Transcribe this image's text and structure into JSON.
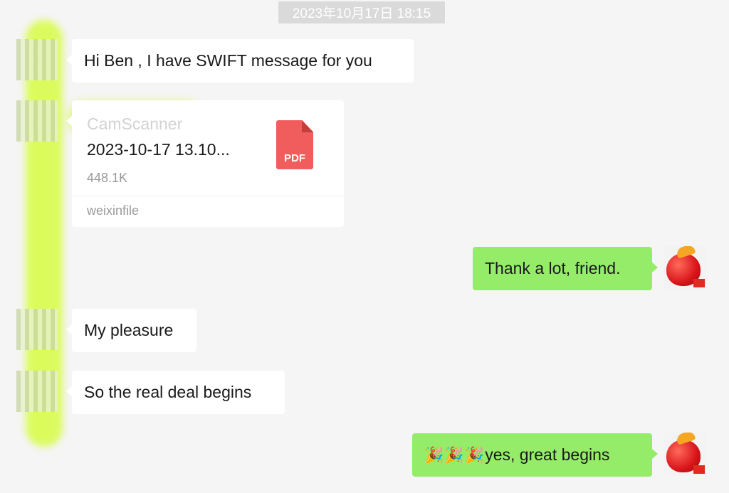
{
  "timestamp": "2023年10月17日 18:15",
  "messages": [
    {
      "text": "Hi Ben , I have SWIFT message for you"
    },
    {
      "text": "Thank a lot, friend."
    },
    {
      "text": "My pleasure"
    },
    {
      "text": "So the real deal begins"
    },
    {
      "emojis": [
        "🎉",
        "🎉",
        "🎉"
      ],
      "text": "yes, great begins"
    }
  ],
  "file": {
    "title_line1": "CamScanner",
    "title_line2": "2023-10-17 13.10...",
    "size": "448.1K",
    "source": "weixinfile",
    "type_label": "PDF"
  },
  "colors": {
    "background": "#f5f5f5",
    "incoming_bubble": "#ffffff",
    "outgoing_bubble": "#95ec69",
    "pdf_icon": "#f15c5c",
    "highlighter": "#d6fc3c"
  },
  "icons": {
    "pdf": "pdf-file-icon",
    "sender_avatar": "contact-avatar",
    "self_avatar": "apple-avatar"
  }
}
